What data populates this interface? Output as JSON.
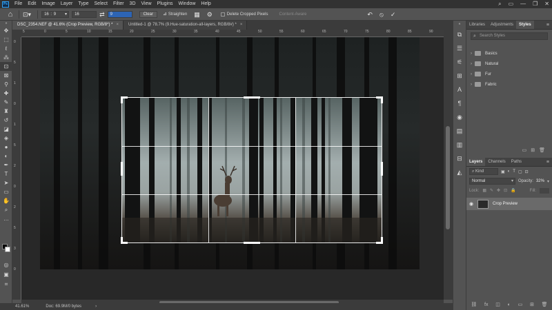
{
  "app": {
    "logo": "Ps",
    "menu": [
      "File",
      "Edit",
      "Image",
      "Layer",
      "Type",
      "Select",
      "Filter",
      "3D",
      "View",
      "Plugins",
      "Window",
      "Help"
    ],
    "window_controls": [
      "⌕",
      "▭",
      "—",
      "❐",
      "✕"
    ]
  },
  "options": {
    "ratio_w": "16",
    "ratio_sep": ":",
    "ratio_h": "9",
    "field_2": "16",
    "swap": "⇄",
    "field_3": "9",
    "clear_label": "Clear",
    "straighten_label": "Straighten",
    "delete_cropped_label": "Delete Cropped Pixels",
    "content_aware_label": "Content-Aware",
    "reset_icon": "↶",
    "cancel_icon": "⦸",
    "commit_icon": "✓"
  },
  "tabs": [
    {
      "label": "DSC_2354.NEF @ 41.6% (Crop Preview, RGB/8*) *",
      "close": "×"
    },
    {
      "label": "Untitled-1 @ 78.7% (9.Hue-saturation-all-layers, RGB/8#) *",
      "close": "×"
    }
  ],
  "ruler": {
    "h": [
      "5",
      "0",
      "5",
      "10",
      "15",
      "20",
      "25",
      "30",
      "35",
      "40",
      "45",
      "50",
      "55",
      "60",
      "65",
      "70",
      "75",
      "80",
      "85",
      "90"
    ],
    "v": [
      "0",
      "5",
      "1",
      "0",
      "1",
      "5",
      "2",
      "0",
      "2",
      "5",
      "3",
      "0"
    ]
  },
  "status": {
    "zoom": "41.61%",
    "doc": "Doc: 69.9M/0 bytes",
    "arrow": "›"
  },
  "styles_panel": {
    "tabs": [
      "Libraries",
      "Adjustments",
      "Styles"
    ],
    "menu": "≡",
    "search_placeholder": "Search Styles",
    "groups": [
      "Basics",
      "Natural",
      "Fur",
      "Fabric"
    ]
  },
  "layers_panel": {
    "tabs": [
      "Layers",
      "Channels",
      "Paths"
    ],
    "menu": "≡",
    "kind": "Kind",
    "blend_mode": "Normal",
    "opacity_label": "Opacity:",
    "opacity_value": "32%",
    "lock_label": "Lock:",
    "fill_label": "Fill:",
    "layer_name": "Crop Preview"
  },
  "canvas": {
    "sky_color": "#8e9a9a",
    "grid_color": "#ffffff"
  }
}
